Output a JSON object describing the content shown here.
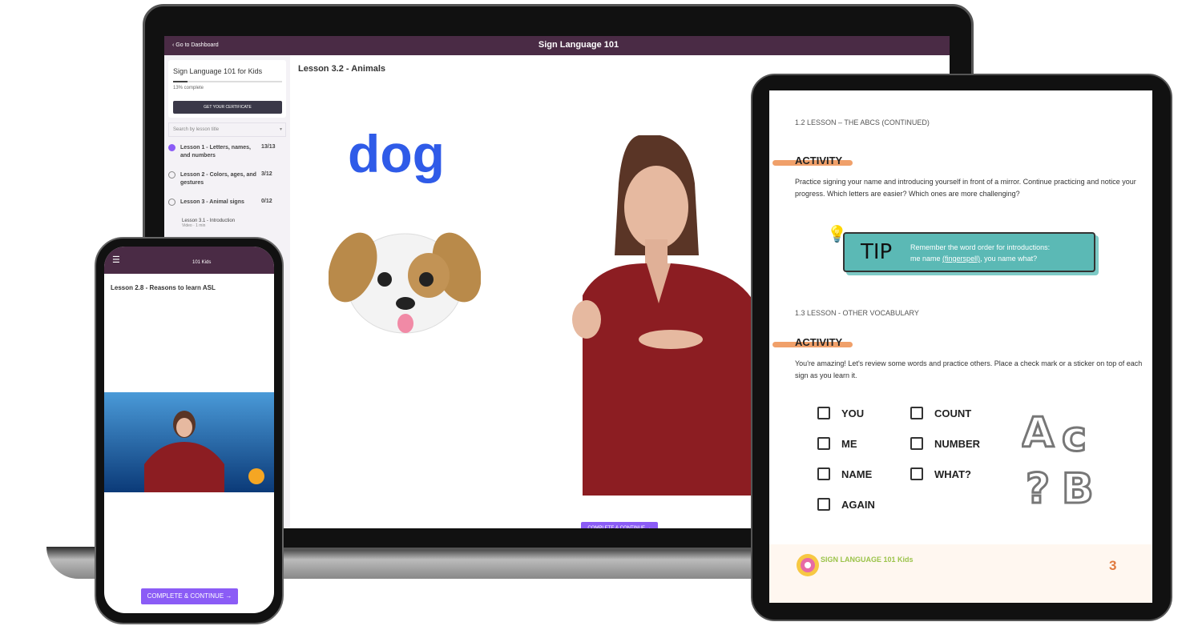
{
  "laptop": {
    "header": {
      "back_label": "Go to Dashboard",
      "title": "Sign Language 101"
    },
    "sidebar": {
      "course_title": "Sign Language 101 for Kids",
      "progress_percent": 13,
      "progress_label": "13% complete",
      "certificate_button": "GET YOUR CERTIFICATE",
      "search_placeholder": "Search by lesson title",
      "lessons": [
        {
          "title": "Lesson 1 - Letters, names, and numbers",
          "count": "13/13",
          "done": true
        },
        {
          "title": "Lesson 2 - Colors, ages, and gestures",
          "count": "3/12",
          "done": false
        },
        {
          "title": "Lesson 3 - Animal signs",
          "count": "0/12",
          "done": false
        }
      ],
      "sublesson": {
        "title": "Lesson 3.1 - Introduction",
        "meta": "Video · 1 min"
      }
    },
    "main": {
      "lesson_title": "Lesson 3.2 - Animals",
      "word": "dog",
      "complete_button": "COMPLETE & CONTINUE →"
    }
  },
  "phone": {
    "logo_text": "101 Kids",
    "lesson_title": "Lesson 2.8 - Reasons to learn ASL",
    "complete_button": "COMPLETE & CONTINUE →"
  },
  "tablet": {
    "section1": "1.2 LESSON – THE ABCS (CONTINUED)",
    "activity_label": "ACTIVITY",
    "activity1_text": "Practice signing your name and introducing yourself in front of a mirror. Continue practicing and notice your progress. Which letters are easier? Which ones are more challenging?",
    "tip": {
      "label": "TIP",
      "line1": "Remember the word order for introductions:",
      "line2_pre": "me name",
      "line2_blank": "(fingerspell)",
      "line2_post": ", you name what?"
    },
    "section2": "1.3 LESSON - OTHER VOCABULARY",
    "activity2_text": "You're amazing! Let's review some words and practice others. Place a check mark or a sticker on top of each sign as you learn it.",
    "words_col1": [
      "YOU",
      "ME",
      "NAME",
      "AGAIN"
    ],
    "words_col2": [
      "COUNT",
      "NUMBER",
      "WHAT?"
    ],
    "footer_logo": "SIGN LANGUAGE 101 Kids",
    "page_number": "3"
  },
  "colors": {
    "header": "#4a2b45",
    "accent": "#8b5cf6",
    "dog_word": "#2f5be8",
    "tip": "#5bb9b5",
    "activity": "#f0a06a",
    "page_number": "#e07a3f"
  }
}
